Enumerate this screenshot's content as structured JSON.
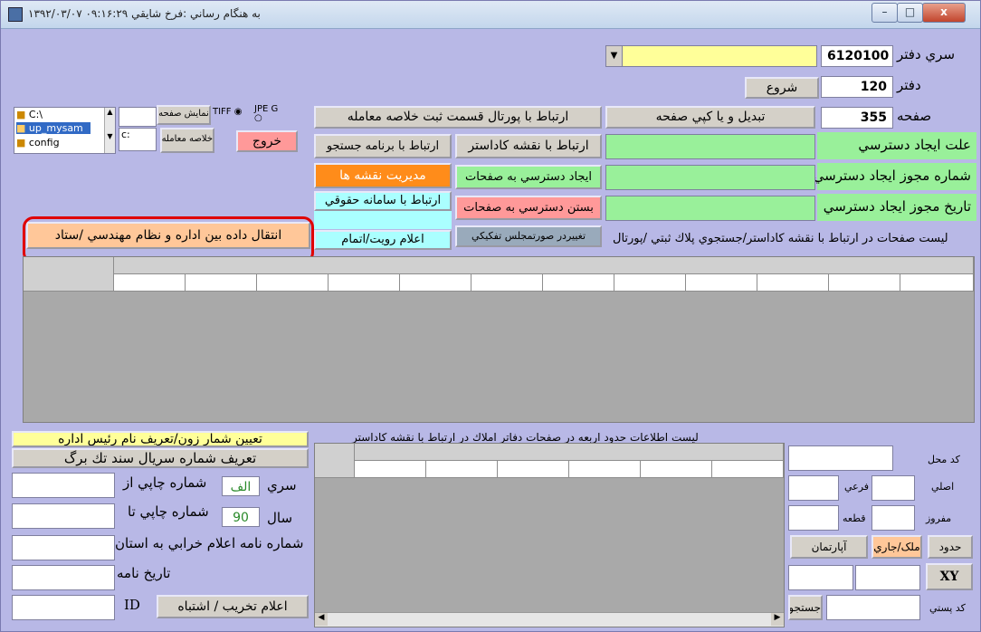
{
  "window": {
    "title": "به هنگام رساني :فرخ شايقي ٠٩:١۶:٢٩ ١٣٩٢/٠٣/٠٧",
    "btn_min": "–",
    "btn_max": "□",
    "btn_close": "x"
  },
  "book": {
    "serial_label": "سري دفتر",
    "serial_value": "6120100",
    "book_label": "دفتر",
    "book_value": "120",
    "start_button": "شروع",
    "page_label": "صفحه",
    "page_value": "355",
    "convert_copy_button": "تبديل و يا كپي صفحه",
    "portal_summary_button": "ارتباط با پورتال قسمت ثبت خلاصه معامله"
  },
  "access": {
    "reason_label": "علت ايجاد دسترسي",
    "permit_no_label": "شماره مجوز ايجاد دسترسي",
    "permit_date_label": "تاريخ مجوز ايجاد دسترسي"
  },
  "buttons": {
    "cadastre_map": "ارتباط با نقشه كاداستر",
    "search_program": "ارتباط با برنامه جستجو",
    "create_access": "ايجاد دسترسي به صفحات",
    "map_management": "مديريت نقشه ها",
    "close_access": "بستن دسترسي به صفحات",
    "legal_system": "ارتباط با سامانه حقوقي",
    "change_separation": "تغييردر صورتمجلس تفكيكي",
    "notify_visit": "اعلام رويت/اتمام",
    "exit": "خروج",
    "summary": "خلاصه معامله",
    "show_page": "نمايش صفحه",
    "transfer": "انتقال داده بين اداره و نظام مهندسي /ستاد",
    "zone_no": "تعيين شمار زون/تعريف نام رئيس اداره",
    "serial_define": "تعريف شماره سريال سند تك برگ",
    "destruction": "اعلام تخريب / اشتباه",
    "search": "جستجو",
    "xy": "XY",
    "apartment": "آپارتمان",
    "property": "ملک/جاري"
  },
  "format": {
    "tiff": "TIFF",
    "jpeg": "JPE G"
  },
  "files": {
    "tree": [
      "C:\\",
      "up_mysam",
      "config"
    ],
    "drive": "c:"
  },
  "list_title": "ليست صفحات در ارتباط با نقشه كاداستر/جستجوي پلاك ثبتي /پورتال",
  "bounds_title": "ليست اطلاعات حدود اربعه در صفحات دفاتر املاك در ارتباط با نقشه كاداستر",
  "left": {
    "series_label": "سري",
    "series_value": "الف",
    "print_from_label": "شماره چاپي از",
    "year_label": "سال",
    "year_value": "90",
    "print_to_label": "شماره چاپي تا",
    "letter_no_label": "شماره نامه اعلام خرابي به استان",
    "letter_date_label": "تاريخ نامه",
    "id_label": "ID"
  },
  "right_bottom": {
    "location_code": "كد محل",
    "main": "اصلي",
    "sub": "فرعي",
    "separated": "مفروز",
    "piece": "قطعه",
    "bounds": "حدود",
    "postal_code": "كد پستي"
  },
  "colors": {
    "bg": "#b8b8e6",
    "green": "#99f09a",
    "yellow": "#ffff99",
    "orange": "#ff8c1a",
    "peach": "#ffc799",
    "pink": "#ff9999",
    "cyan": "#aaffff",
    "red_outline": "#e00000"
  }
}
